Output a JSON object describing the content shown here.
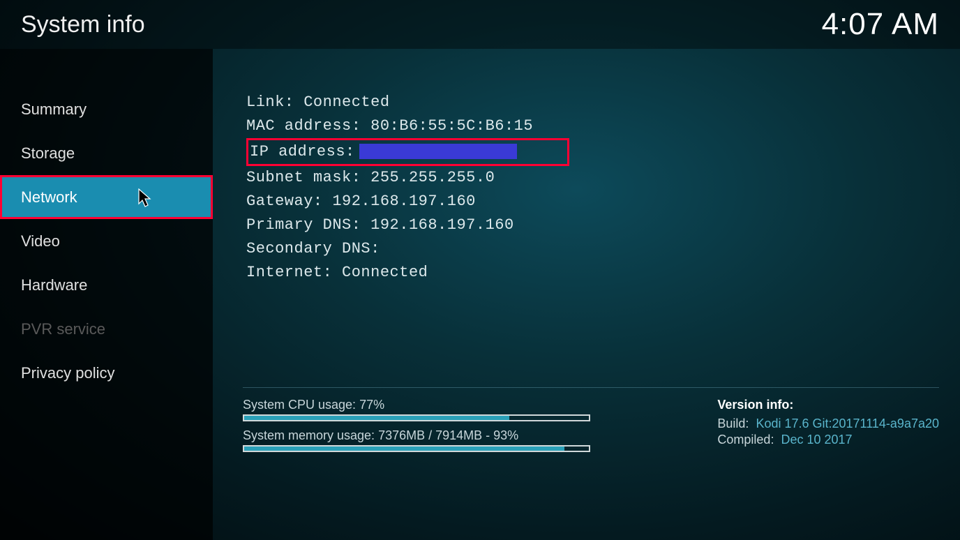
{
  "header": {
    "title": "System info",
    "clock": "4:07 AM"
  },
  "sidebar": {
    "items": [
      {
        "label": "Summary",
        "active": false,
        "disabled": false
      },
      {
        "label": "Storage",
        "active": false,
        "disabled": false
      },
      {
        "label": "Network",
        "active": true,
        "disabled": false,
        "highlighted": true
      },
      {
        "label": "Video",
        "active": false,
        "disabled": false
      },
      {
        "label": "Hardware",
        "active": false,
        "disabled": false
      },
      {
        "label": "PVR service",
        "active": false,
        "disabled": true
      },
      {
        "label": "Privacy policy",
        "active": false,
        "disabled": false
      }
    ]
  },
  "network": {
    "link_label": "Link:",
    "link_value": "Connected",
    "mac_label": "MAC address:",
    "mac_value": "80:B6:55:5C:B6:15",
    "ip_label": "IP address:",
    "ip_value": "",
    "subnet_label": "Subnet mask:",
    "subnet_value": "255.255.255.0",
    "gateway_label": "Gateway:",
    "gateway_value": "192.168.197.160",
    "primary_dns_label": "Primary DNS:",
    "primary_dns_value": "192.168.197.160",
    "secondary_dns_label": "Secondary DNS:",
    "secondary_dns_value": "",
    "internet_label": "Internet:",
    "internet_value": "Connected"
  },
  "footer": {
    "cpu_label": "System CPU usage: 77%",
    "cpu_pct": 77,
    "mem_label": "System memory usage: 7376MB / 7914MB - 93%",
    "mem_pct": 93,
    "version_title": "Version info:",
    "build_label": "Build:",
    "build_value": "Kodi 17.6 Git:20171114-a9a7a20",
    "compiled_label": "Compiled:",
    "compiled_value": "Dec 10 2017"
  }
}
